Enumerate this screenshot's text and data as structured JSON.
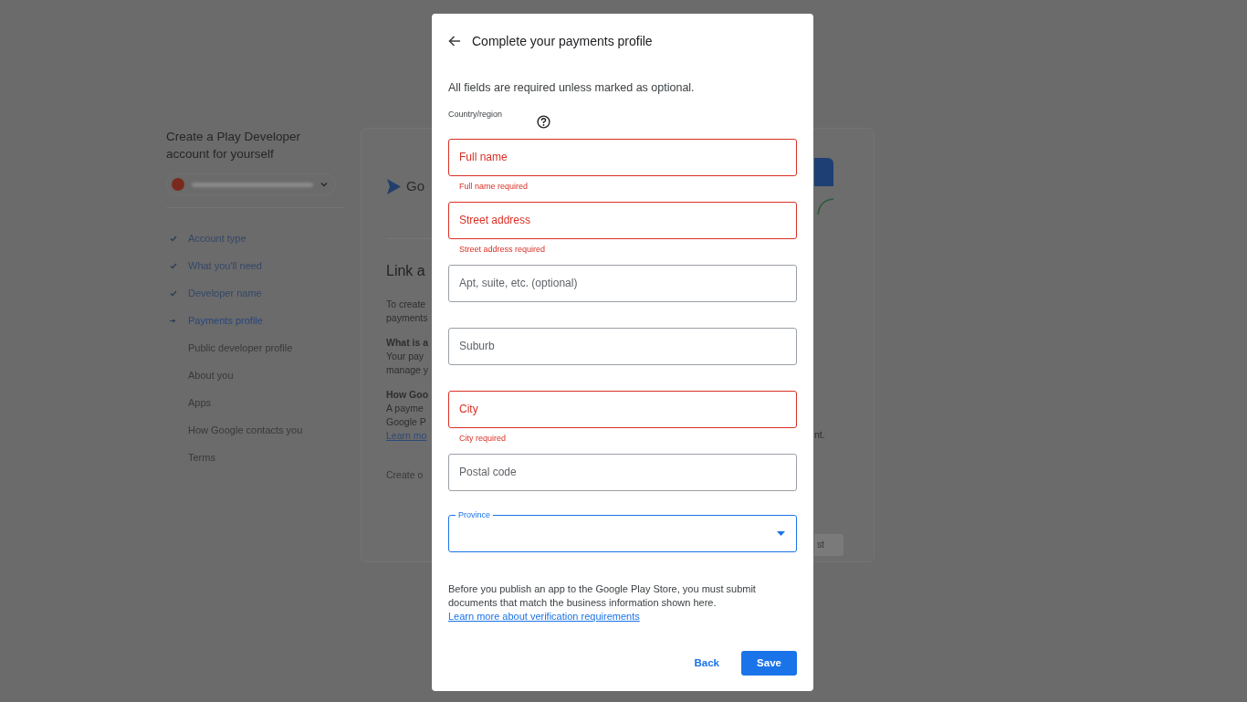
{
  "sidebar": {
    "title": "Create a Play Developer account for yourself",
    "steps": [
      {
        "label": "Account type",
        "completed": true,
        "selected": false
      },
      {
        "label": "What you'll need",
        "completed": true,
        "selected": false
      },
      {
        "label": "Developer name",
        "completed": true,
        "selected": false
      },
      {
        "label": "Payments profile",
        "completed": false,
        "selected": true
      },
      {
        "label": "Public developer profile",
        "completed": false,
        "selected": false
      },
      {
        "label": "About you",
        "completed": false,
        "selected": false
      },
      {
        "label": "Apps",
        "completed": false,
        "selected": false
      },
      {
        "label": "How Google contacts you",
        "completed": false,
        "selected": false
      },
      {
        "label": "Terms",
        "completed": false,
        "selected": false
      }
    ]
  },
  "card": {
    "logo_text": "Go",
    "heading": "Link a",
    "groups": [
      {
        "lines": [
          "To create",
          "payments"
        ]
      },
      {
        "bold": "What is a",
        "lines": [
          "Your pay",
          "manage y"
        ]
      },
      {
        "bold": "How Goo",
        "lines": [
          "A payme",
          "Google P"
        ],
        "link": "Learn mo"
      }
    ],
    "faint": "Create o",
    "right_text": "nt.",
    "right_button": "st"
  },
  "dialog": {
    "title": "Complete your payments profile",
    "intro": "All fields are required unless marked as optional.",
    "country_label": "Country/region",
    "fields": [
      {
        "placeholder": "Full name",
        "invalid": true,
        "error": "Full name required"
      },
      {
        "placeholder": "Street address",
        "invalid": true,
        "error": "Street address required"
      },
      {
        "placeholder": "Apt, suite, etc. (optional)",
        "invalid": false
      },
      {
        "placeholder": "Suburb",
        "invalid": false
      },
      {
        "placeholder": "City",
        "invalid": true,
        "error": "City required"
      },
      {
        "placeholder": "Postal code",
        "invalid": false
      }
    ],
    "province": {
      "label": "Province",
      "focused": true
    },
    "notice": {
      "text": "Before you publish an app to the Google Play Store, you must submit documents that match the business information shown here.",
      "link": "Learn more about verification requirements"
    },
    "buttons": [
      {
        "label": "Back",
        "kind": "text"
      },
      {
        "label": "Save",
        "kind": "primary"
      }
    ]
  }
}
